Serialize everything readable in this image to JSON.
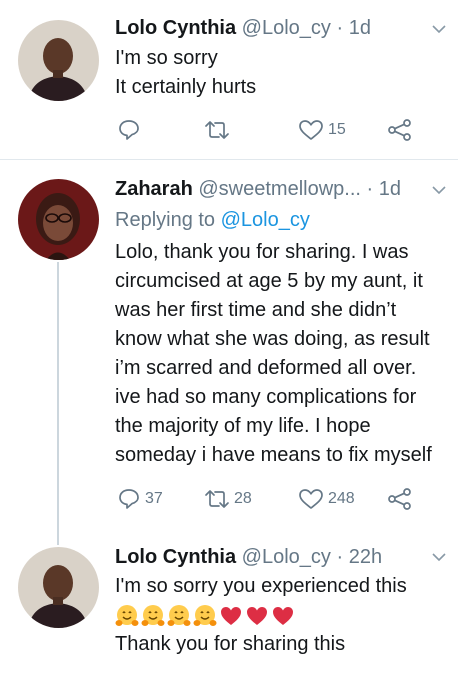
{
  "tweets": [
    {
      "name": "Lolo Cynthia",
      "handle": "@Lolo_cy",
      "sep": "·",
      "time": "1d",
      "lines": [
        "I'm so sorry",
        "It certainly hurts"
      ],
      "actions": {
        "reply": "",
        "retweet": "",
        "like": "15"
      }
    },
    {
      "name": "Zaharah",
      "handle": "@sweetmellowp...",
      "sep": "·",
      "time": "1d",
      "replying_to_prefix": "Replying to",
      "replying_to_handle": "@Lolo_cy",
      "lines": [
        "Lolo, thank you for sharing. I was",
        "circumcised at age 5 by my aunt, it",
        "was her first time and she didn’t",
        "know what she was doing, as result",
        "i’m scarred and deformed  all over.",
        "ive had so many complications for",
        "the majority of my life. I hope",
        "someday i have means to fix myself"
      ],
      "actions": {
        "reply": "37",
        "retweet": "28",
        "like": "248"
      }
    },
    {
      "name": "Lolo Cynthia",
      "handle": "@Lolo_cy",
      "sep": "·",
      "time": "22h",
      "line1": "I'm so sorry you experienced this",
      "emojis": [
        "hugging-face",
        "hugging-face",
        "hugging-face",
        "hugging-face",
        "red-heart",
        "red-heart",
        "red-heart"
      ],
      "line3": "Thank you for sharing this"
    }
  ],
  "colors": {
    "text": "#14171a",
    "muted": "#657786",
    "link": "#1b95e0",
    "divider": "#e1e8ed",
    "thread": "#ccd6dd",
    "emoji_face": "#ffcc4d",
    "heart": "#dd2e44"
  }
}
